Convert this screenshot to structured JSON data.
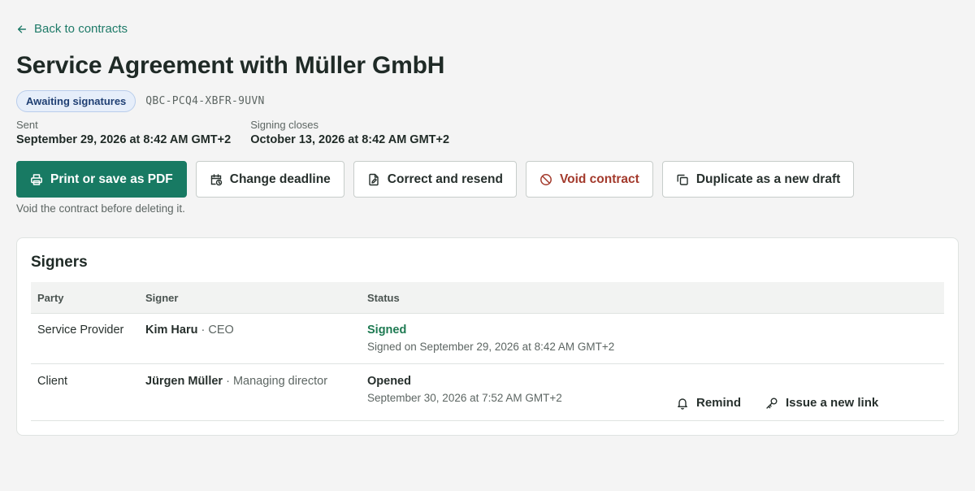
{
  "nav": {
    "back_label": "Back to contracts"
  },
  "contract": {
    "title": "Service Agreement with Müller GmbH",
    "status_badge": "Awaiting signatures",
    "id": "QBC-PCQ4-XBFR-9UVN",
    "sent_label": "Sent",
    "sent_value": "September 29, 2026 at 8:42 AM GMT+2",
    "closes_label": "Signing closes",
    "closes_value": "October 13, 2026 at 8:42 AM GMT+2"
  },
  "actions": {
    "print": "Print or save as PDF",
    "deadline": "Change deadline",
    "resend": "Correct and resend",
    "void": "Void contract",
    "duplicate": "Duplicate as a new draft",
    "hint": "Void the contract before deleting it."
  },
  "signers": {
    "title": "Signers",
    "headers": {
      "party": "Party",
      "signer": "Signer",
      "status": "Status"
    },
    "rows": [
      {
        "party": "Service Provider",
        "name": "Kim Haru",
        "role": " · CEO",
        "status": "Signed",
        "status_detail": "Signed on September 29, 2026 at 8:42 AM GMT+2"
      },
      {
        "party": "Client",
        "name": "Jürgen Müller",
        "role": " · Managing director",
        "status": "Opened",
        "status_detail": "September 30, 2026 at 7:52 AM GMT+2",
        "remind_label": "Remind",
        "new_link_label": "Issue a new link"
      }
    ]
  },
  "colors": {
    "accent": "#187a63",
    "signed": "#1e7a52",
    "danger": "#a33a2c",
    "badge_bg": "#e6eefa"
  }
}
